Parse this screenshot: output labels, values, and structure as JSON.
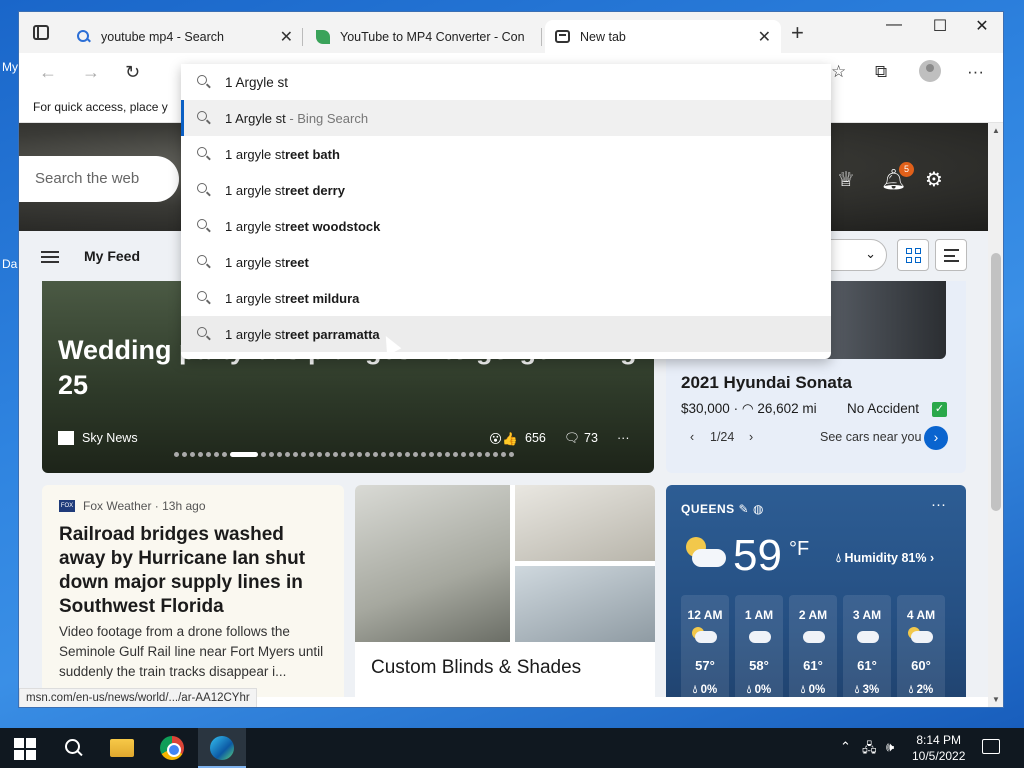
{
  "desktop": {
    "fragment_1": "My",
    "fragment_2": "Da"
  },
  "browser": {
    "tabs": [
      {
        "title": "youtube mp4 - Search",
        "icon": "search-icon"
      },
      {
        "title": "YouTube to MP4 Converter - Con",
        "icon": "leaf-favicon"
      },
      {
        "title": "New tab",
        "icon": "newtab-icon",
        "active": true
      }
    ],
    "favorites_bar_text": "For quick access, place y",
    "status_url": "msn.com/en-us/news/world/.../ar-AA12CYhr"
  },
  "omnibox": {
    "value": "1 Argyle st",
    "suggestions": [
      {
        "prefix": "1 Argyle st",
        "bold": "",
        "hint": " - Bing Search",
        "selected": true
      },
      {
        "prefix": "1 argyle st",
        "bold": "reet bath"
      },
      {
        "prefix": "1 argyle st",
        "bold": "reet derry"
      },
      {
        "prefix": "1 argyle st",
        "bold": "reet woodstock"
      },
      {
        "prefix": "1 argyle st",
        "bold": "reet"
      },
      {
        "prefix": "1 argyle st",
        "bold": "reet mildura"
      },
      {
        "prefix": "1 argyle st",
        "bold": "reet parramatta",
        "hovered": true
      }
    ]
  },
  "msn": {
    "search_placeholder": "Search the web",
    "notification_count": "5",
    "feed_label": "My Feed",
    "hero_story": {
      "title": "Wedding party bus plunges into gorge killing 25",
      "source": "Sky News",
      "reactions": "656",
      "comments": "73"
    },
    "car_ad": {
      "title": "2021 Hyundai Sonata",
      "price": "$30,000",
      "mileage": "26,602 mi",
      "history": "No Accident",
      "pager": "1/24",
      "cta": "See cars near you"
    },
    "fox_story": {
      "source_logo": "FOX",
      "meta": "Fox Weather · 13h ago",
      "title": "Railroad bridges washed away by Hurricane Ian shut down major supply lines in Southwest Florida",
      "desc": "Video footage from a drone follows the Seminole Gulf Rail line near Fort Myers until suddenly the train tracks disappear i..."
    },
    "ad_card": {
      "title": "Custom Blinds & Shades"
    },
    "weather": {
      "city": "QUEENS",
      "temp": "59",
      "unit": "°F",
      "humidity": "Humidity 81%",
      "hours": [
        {
          "h": "12 AM",
          "t": "57°",
          "p": "0%",
          "icon": "partly-cloudy"
        },
        {
          "h": "1 AM",
          "t": "58°",
          "p": "0%",
          "icon": "cloudy"
        },
        {
          "h": "2 AM",
          "t": "61°",
          "p": "0%",
          "icon": "cloudy"
        },
        {
          "h": "3 AM",
          "t": "61°",
          "p": "3%",
          "icon": "cloudy"
        },
        {
          "h": "4 AM",
          "t": "60°",
          "p": "2%",
          "icon": "partly-cloudy"
        }
      ]
    }
  },
  "taskbar": {
    "time": "8:14 PM",
    "date": "10/5/2022"
  },
  "colors": {
    "accent": "#0a64cf",
    "taskbar": "#101820",
    "weather_bg": "#2d5d94"
  }
}
